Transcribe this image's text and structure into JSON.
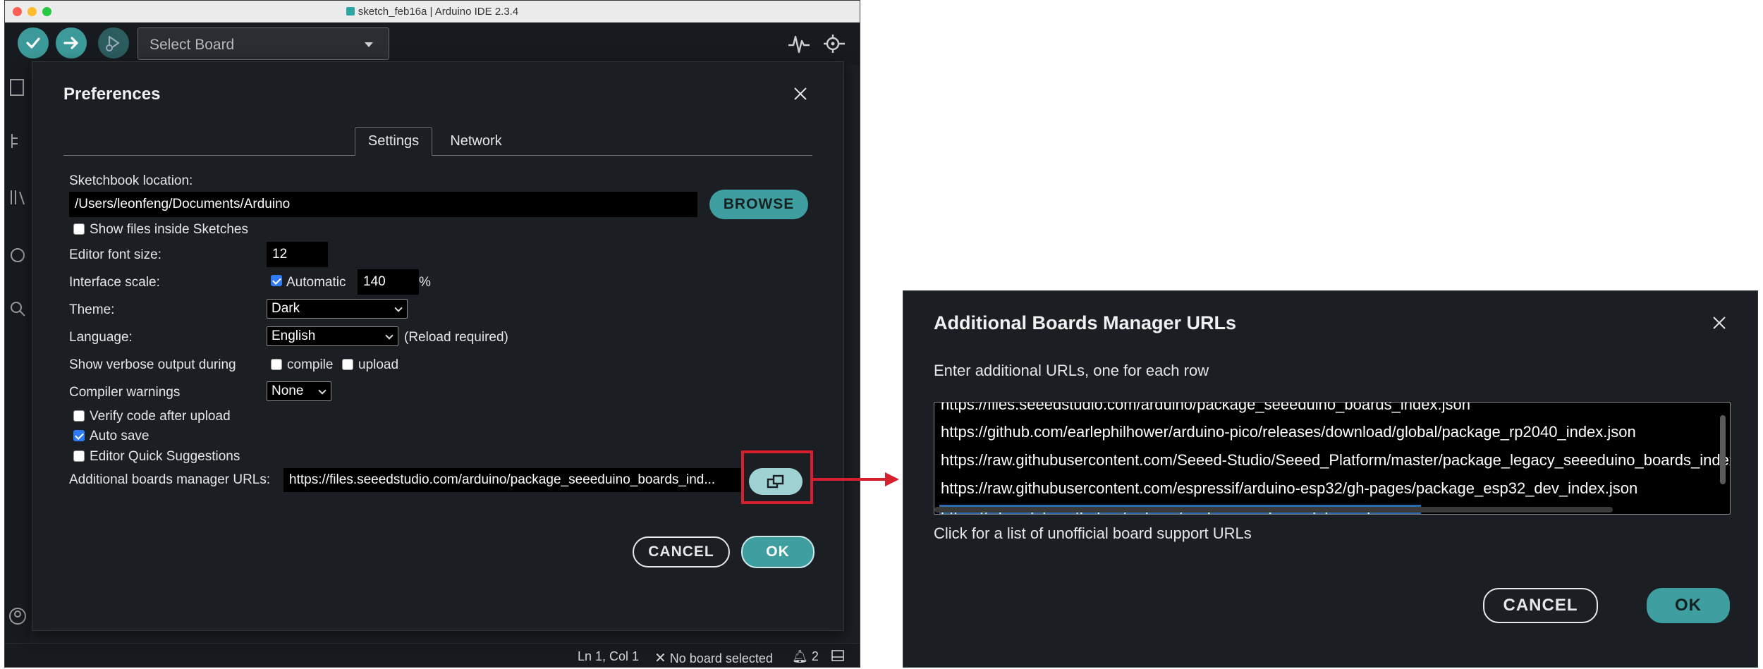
{
  "window": {
    "title": "sketch_feb16a | Arduino IDE 2.3.4"
  },
  "toolbar": {
    "verify_icon": "checkmark-icon",
    "upload_icon": "arrow-right-icon",
    "debug_icon": "debug-play-icon",
    "board_select_label": "Select Board",
    "plotter_icon": "serial-plotter-icon",
    "monitor_icon": "serial-monitor-icon"
  },
  "sidebar": {
    "items": [
      "folder-icon",
      "boards-manager-icon",
      "library-manager-icon",
      "debug-icon",
      "search-icon",
      "account-icon"
    ]
  },
  "status_bar": {
    "position": "Ln 1, Col 1",
    "board": "No board selected",
    "notifications_count": "2",
    "board_icon": "close-icon",
    "notifications_icon": "bell-icon",
    "panel_icon": "panel-toggle-icon"
  },
  "preferences": {
    "title": "Preferences",
    "tabs": [
      {
        "label": "Settings",
        "active": true
      },
      {
        "label": "Network",
        "active": false
      }
    ],
    "sketchbook_label": "Sketchbook location:",
    "sketchbook_path": "/Users/leonfeng/Documents/Arduino",
    "browse_label": "BROWSE",
    "show_files_label": "Show files inside Sketches",
    "show_files_checked": false,
    "font_size_label": "Editor font size:",
    "font_size_value": "12",
    "scale_label": "Interface scale:",
    "scale_auto_label": "Automatic",
    "scale_auto_checked": true,
    "scale_value": "140",
    "scale_unit": "%",
    "theme_label": "Theme:",
    "theme_value": "Dark",
    "language_label": "Language:",
    "language_value": "English",
    "language_note": "(Reload required)",
    "verbose_label": "Show verbose output during",
    "verbose_compile_label": "compile",
    "verbose_upload_label": "upload",
    "warnings_label": "Compiler warnings",
    "warnings_value": "None",
    "verify_label": "Verify code after upload",
    "verify_checked": false,
    "autosave_label": "Auto save",
    "autosave_checked": true,
    "quick_suggestions_label": "Editor Quick Suggestions",
    "quick_suggestions_checked": false,
    "urls_label": "Additional boards manager URLs:",
    "urls_value": "https://files.seeedstudio.com/arduino/package_seeeduino_boards_ind...",
    "urls_button_icon": "open-window-icon",
    "cancel_label": "CANCEL",
    "ok_label": "OK"
  },
  "urls_dialog": {
    "title": "Additional Boards Manager URLs",
    "subtitle": "Enter additional URLs, one for each row",
    "lines": [
      "https://files.seeedstudio.com/arduino/package_seeeduino_boards_index.json",
      "https://github.com/earlephilhower/arduino-pico/releases/download/global/package_rp2040_index.json",
      "https://raw.githubusercontent.com/Seeed-Studio/Seeed_Platform/master/package_legacy_seeeduino_boards_index.json",
      "https://raw.githubusercontent.com/espressif/arduino-esp32/gh-pages/package_esp32_dev_index.json",
      "https://siliconlabs.github.io/arduino/package_arduinosilabs_index.json"
    ],
    "selected_line": 4,
    "link_text": "Click for a list of unofficial board support URLs",
    "cancel_label": "CANCEL",
    "ok_label": "OK"
  },
  "colors": {
    "accent": "#3f9ea0",
    "highlight": "#d6202f",
    "selection": "#2a6bb0"
  }
}
